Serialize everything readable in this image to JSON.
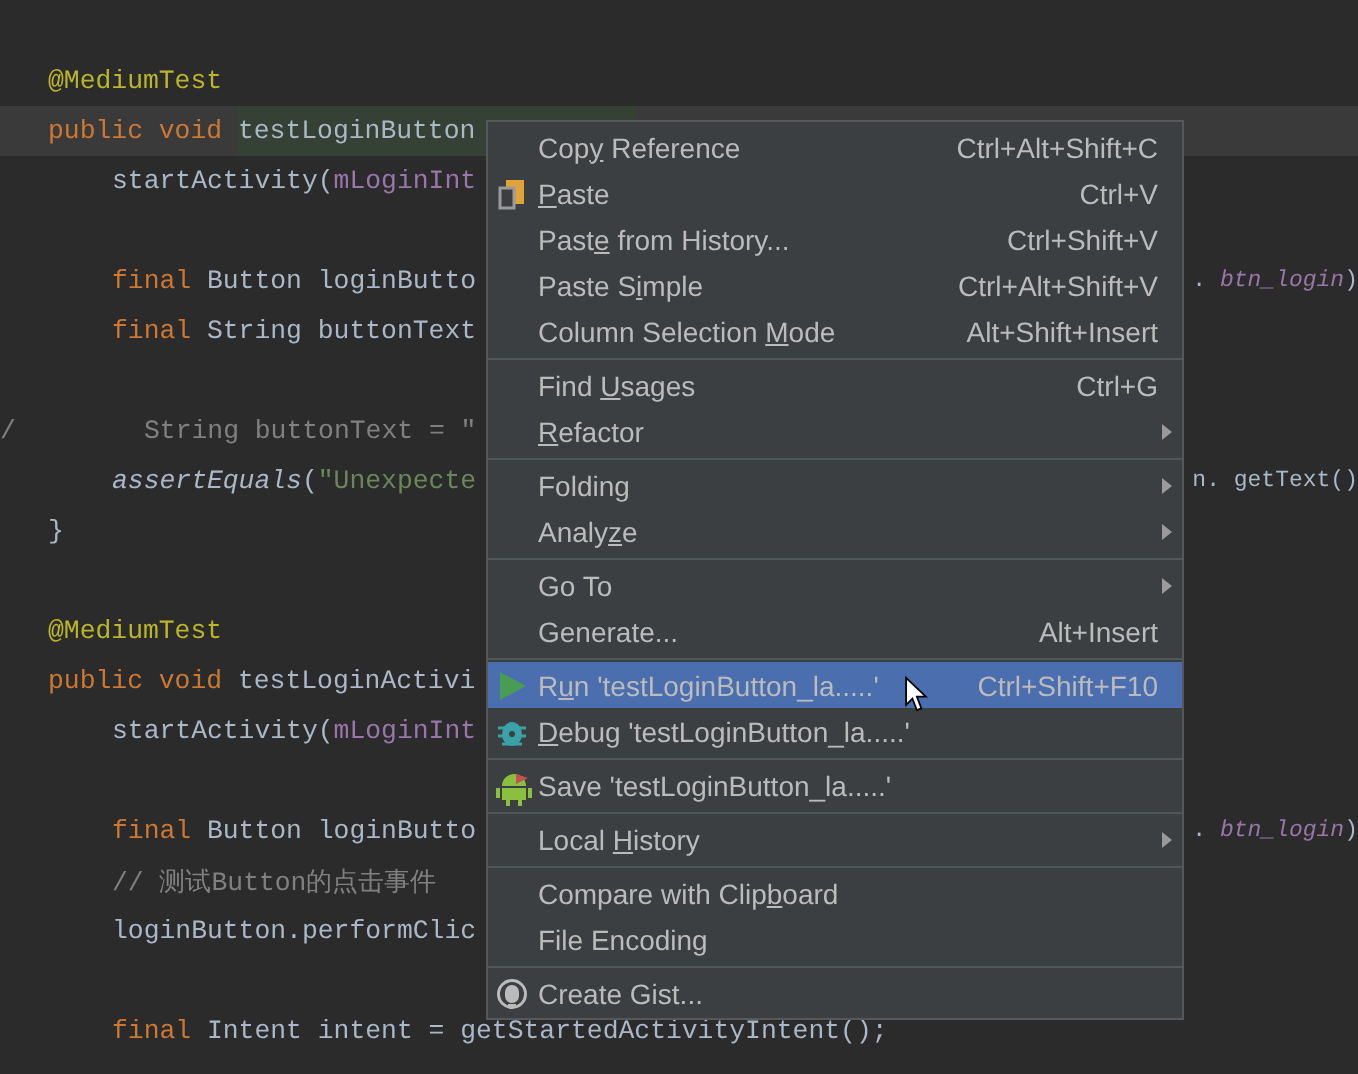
{
  "code_lines": [
    {
      "kind": "member",
      "current": false,
      "tokens": [
        {
          "kind": "annotation",
          "text": "@MediumTest"
        }
      ]
    },
    {
      "kind": "member",
      "current": true,
      "tokens": [
        {
          "kind": "keyword",
          "text": "public void "
        },
        {
          "kind": "usage",
          "text": "testLoginButton"
        }
      ]
    },
    {
      "kind": "statement",
      "current": false,
      "tokens": [
        {
          "kind": "plain",
          "text": "startActivity("
        },
        {
          "kind": "field",
          "text": "mLoginInt"
        }
      ]
    },
    {
      "kind": "blank",
      "current": false
    },
    {
      "kind": "statement",
      "current": false,
      "tokens": [
        {
          "kind": "keyword",
          "text": "final "
        },
        {
          "kind": "plain",
          "text": "Button loginButto"
        }
      ],
      "right": [
        {
          "kind": "plain",
          "text": ". "
        },
        {
          "kind": "field_italic",
          "text": "btn_login"
        },
        {
          "kind": "plain",
          "text": ")"
        }
      ]
    },
    {
      "kind": "statement",
      "current": false,
      "tokens": [
        {
          "kind": "keyword",
          "text": "final "
        },
        {
          "kind": "plain",
          "text": "String buttonText"
        }
      ]
    },
    {
      "kind": "blank",
      "current": false
    },
    {
      "kind": "commented_out",
      "current": false,
      "gutter": "/",
      "tokens": [
        {
          "kind": "comment",
          "text": "String buttonText = \""
        }
      ]
    },
    {
      "kind": "statement",
      "current": false,
      "tokens": [
        {
          "kind": "static_italic",
          "text": "assertEquals"
        },
        {
          "kind": "plain",
          "text": "("
        },
        {
          "kind": "string",
          "text": "\"Unexpecte"
        }
      ],
      "right": [
        {
          "kind": "plain",
          "text": "n. getText()"
        }
      ]
    },
    {
      "kind": "member",
      "current": false,
      "tokens": [
        {
          "kind": "plain",
          "text": "}"
        }
      ]
    },
    {
      "kind": "blank",
      "current": false
    },
    {
      "kind": "member",
      "current": false,
      "tokens": [
        {
          "kind": "annotation",
          "text": "@MediumTest"
        }
      ]
    },
    {
      "kind": "member",
      "current": false,
      "tokens": [
        {
          "kind": "keyword",
          "text": "public void "
        },
        {
          "kind": "plain",
          "text": "testLoginActivi"
        }
      ]
    },
    {
      "kind": "statement",
      "current": false,
      "tokens": [
        {
          "kind": "plain",
          "text": "startActivity("
        },
        {
          "kind": "field",
          "text": "mLoginInt"
        }
      ]
    },
    {
      "kind": "blank",
      "current": false
    },
    {
      "kind": "statement",
      "current": false,
      "tokens": [
        {
          "kind": "keyword",
          "text": "final "
        },
        {
          "kind": "plain",
          "text": "Button loginButto"
        }
      ],
      "right": [
        {
          "kind": "plain",
          "text": ". "
        },
        {
          "kind": "field_italic",
          "text": "btn_login"
        },
        {
          "kind": "plain",
          "text": ")"
        }
      ]
    },
    {
      "kind": "statement",
      "current": false,
      "tokens": [
        {
          "kind": "comment",
          "text": "// 测试Button的点击事件"
        }
      ]
    },
    {
      "kind": "statement",
      "current": false,
      "tokens": [
        {
          "kind": "plain",
          "text": "loginButton.performClic"
        }
      ]
    },
    {
      "kind": "blank",
      "current": false
    },
    {
      "kind": "statement",
      "current": false,
      "tokens": [
        {
          "kind": "keyword",
          "text": "final "
        },
        {
          "kind": "plain",
          "text": "Intent intent = getStartedActivityIntent();"
        }
      ]
    }
  ],
  "context_menu": {
    "groups": [
      [
        {
          "kind": "plain",
          "pre": "Cop",
          "key": "y",
          "post": " Reference",
          "shortcut": "Ctrl+Alt+Shift+C",
          "submenu": false,
          "selected": false
        },
        {
          "kind": "paste",
          "key": "P",
          "post": "aste",
          "shortcut": "Ctrl+V",
          "submenu": false,
          "selected": false
        },
        {
          "kind": "plain",
          "pre": "Past",
          "key": "e",
          "post": " from History...",
          "shortcut": "Ctrl+Shift+V",
          "submenu": false,
          "selected": false
        },
        {
          "kind": "plain",
          "pre": "Paste S",
          "key": "i",
          "post": "mple",
          "shortcut": "Ctrl+Alt+Shift+V",
          "submenu": false,
          "selected": false
        },
        {
          "kind": "plain",
          "pre": "Column Selection ",
          "key": "M",
          "post": "ode",
          "shortcut": "Alt+Shift+Insert",
          "submenu": false,
          "selected": false
        }
      ],
      [
        {
          "kind": "plain",
          "pre": "Find ",
          "key": "U",
          "post": "sages",
          "shortcut": "Ctrl+G",
          "submenu": false,
          "selected": false
        },
        {
          "kind": "plain",
          "key": "R",
          "post": "efactor",
          "submenu": true,
          "selected": false
        }
      ],
      [
        {
          "kind": "plain",
          "pre": "Folding",
          "submenu": true,
          "selected": false
        },
        {
          "kind": "plain",
          "pre": "Analy",
          "key": "z",
          "post": "e",
          "submenu": true,
          "selected": false
        }
      ],
      [
        {
          "kind": "plain",
          "pre": "Go To",
          "submenu": true,
          "selected": false
        },
        {
          "kind": "plain",
          "pre": "Generate...",
          "shortcut": "Alt+Insert",
          "submenu": false,
          "selected": false
        }
      ],
      [
        {
          "kind": "run",
          "pre": "R",
          "key": "u",
          "post": "n 'testLoginButton_la.....'",
          "shortcut": "Ctrl+Shift+F10",
          "submenu": false,
          "selected": true
        },
        {
          "kind": "debug",
          "key": "D",
          "post": "ebug 'testLoginButton_la.....'",
          "submenu": false,
          "selected": false
        }
      ],
      [
        {
          "kind": "save",
          "pre": "Save 'testLoginButton_la.....'",
          "submenu": false,
          "selected": false
        }
      ],
      [
        {
          "kind": "plain",
          "pre": "Local ",
          "key": "H",
          "post": "istory",
          "submenu": true,
          "selected": false
        }
      ],
      [
        {
          "kind": "plain",
          "pre": "Compare with Clip",
          "key": "b",
          "post": "oard",
          "submenu": false,
          "selected": false
        },
        {
          "kind": "plain",
          "pre": "File Encoding",
          "submenu": false,
          "selected": false
        }
      ],
      [
        {
          "kind": "gist",
          "pre": "Create Gist...",
          "submenu": false,
          "selected": false
        }
      ]
    ]
  }
}
